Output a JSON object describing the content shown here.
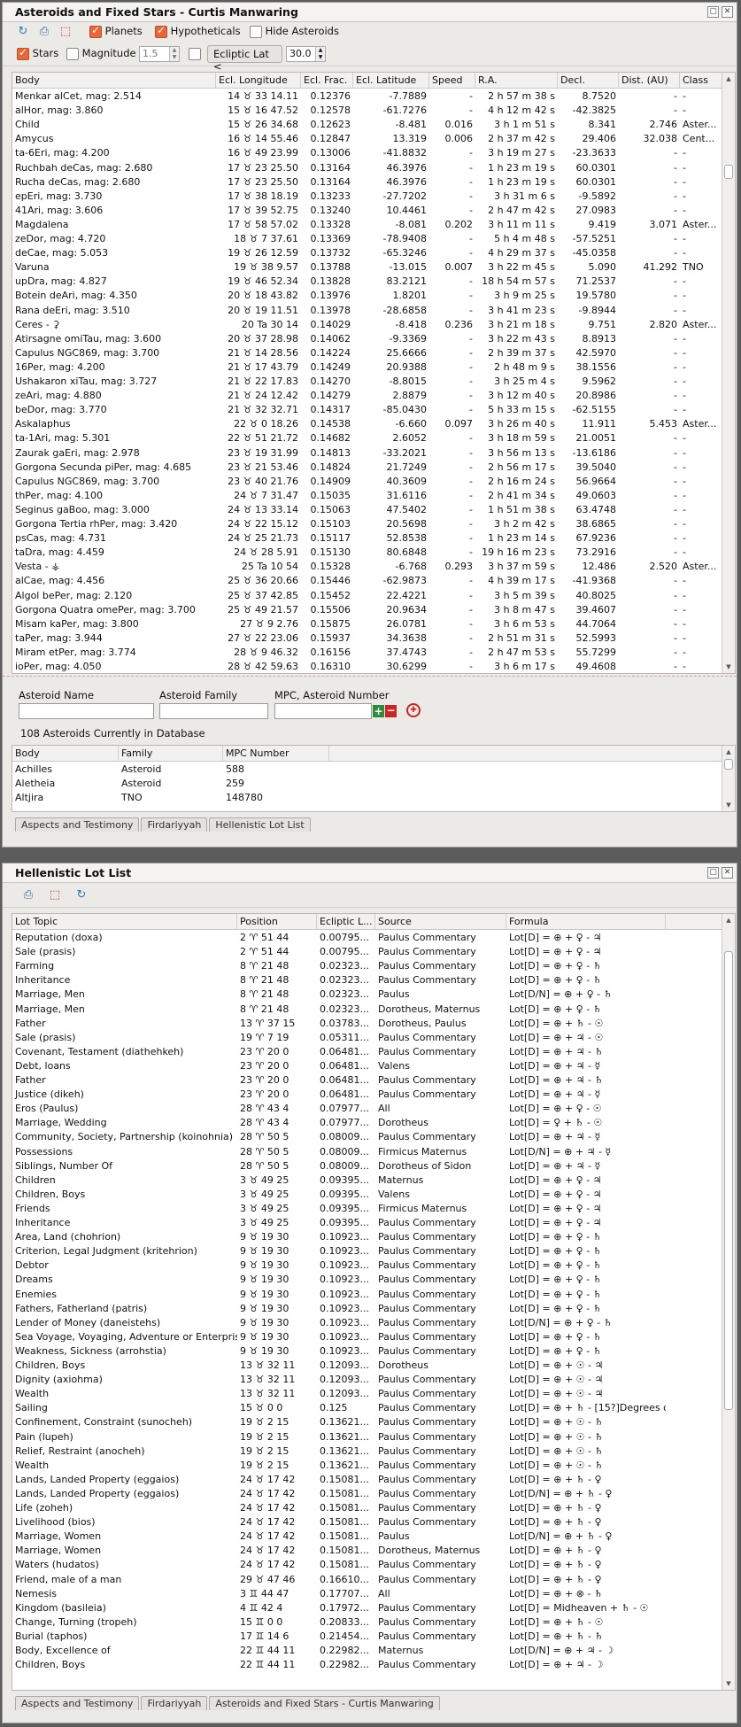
{
  "top": {
    "title": "Asteroids and Fixed Stars - Curtis Manwaring",
    "toolbar": {
      "planets": "Planets",
      "hypotheticals": "Hypotheticals",
      "hide": "Hide Asteroids",
      "stars": "Stars",
      "magnitude": "Magnitude <",
      "mag_value": "1.5",
      "ecliptic": "Ecliptic Lat <",
      "ecl_value": "30.0"
    },
    "columns": [
      "Body",
      "Ecl. Longitude",
      "Ecl. Frac.",
      "Ecl. Latitude",
      "Speed",
      "R.A.",
      "Decl.",
      "Dist. (AU)",
      "Class"
    ],
    "rows": [
      [
        "Menkar   alCet, mag: 2.514",
        "14 ♉ 33 14.11",
        "0.12376",
        "-7.7889",
        "-",
        "2 h 57 m 38 s",
        "8.7520",
        "-",
        "-"
      ],
      [
        "   alHor, mag: 3.860",
        "15 ♉ 16 47.52",
        "0.12578",
        "-61.7276",
        "-",
        "4 h 12 m 42 s",
        "-42.3825",
        "-",
        "-"
      ],
      [
        "Child",
        "15 ♉ 26 34.68",
        "0.12623",
        "-8.481",
        "0.016",
        "3 h 1 m 51 s",
        "8.341",
        "2.746",
        "Aster..."
      ],
      [
        "Amycus",
        "16 ♉ 14 55.46",
        "0.12847",
        "13.319",
        "0.006",
        "2 h 37 m 42 s",
        "29.406",
        "32.038",
        "Cent..."
      ],
      [
        "   ta-6Eri, mag: 4.200",
        "16 ♉ 49 23.99",
        "0.13006",
        "-41.8832",
        "-",
        "3 h 19 m 27 s",
        "-23.3633",
        "-",
        "-"
      ],
      [
        "Ruchbah   deCas, mag: 2.680",
        "17 ♉ 23 25.50",
        "0.13164",
        "46.3976",
        "-",
        "1 h 23 m 19 s",
        "60.0301",
        "-",
        "-"
      ],
      [
        "Rucha   deCas, mag: 2.680",
        "17 ♉ 23 25.50",
        "0.13164",
        "46.3976",
        "-",
        "1 h 23 m 19 s",
        "60.0301",
        "-",
        "-"
      ],
      [
        "   epEri, mag: 3.730",
        "17 ♉ 38 18.19",
        "0.13233",
        "-27.7202",
        "-",
        "3 h 31 m 6 s",
        "-9.5892",
        "-",
        "-"
      ],
      [
        "   41Ari, mag: 3.606",
        "17 ♉ 39 52.75",
        "0.13240",
        "10.4461",
        "-",
        "2 h 47 m 42 s",
        "27.0983",
        "-",
        "-"
      ],
      [
        "Magdalena",
        "17 ♉ 58 57.02",
        "0.13328",
        "-8.081",
        "0.202",
        "3 h 11 m 11 s",
        "9.419",
        "3.071",
        "Aster..."
      ],
      [
        "   zeDor, mag: 4.720",
        "18 ♉ 7 37.61",
        "0.13369",
        "-78.9408",
        "-",
        "5 h 4 m 48 s",
        "-57.5251",
        "-",
        "-"
      ],
      [
        "   deCae, mag: 5.053",
        "19 ♉ 26 12.59",
        "0.13732",
        "-65.3246",
        "-",
        "4 h 29 m 37 s",
        "-45.0358",
        "-",
        "-"
      ],
      [
        "Varuna",
        "19 ♉ 38 9.57",
        "0.13788",
        "-13.015",
        "0.007",
        "3 h 22 m 45 s",
        "5.090",
        "41.292",
        "TNO"
      ],
      [
        "   upDra, mag: 4.827",
        "19 ♉ 46 52.34",
        "0.13828",
        "83.2121",
        "-",
        "18 h 54 m 57 s",
        "71.2537",
        "-",
        "-"
      ],
      [
        "Botein   deAri, mag: 4.350",
        "20 ♉ 18 43.82",
        "0.13976",
        "1.8201",
        "-",
        "3 h 9 m 25 s",
        "19.5780",
        "-",
        "-"
      ],
      [
        "Rana   deEri, mag: 3.510",
        "20 ♉ 19 11.51",
        "0.13978",
        "-28.6858",
        "-",
        "3 h 41 m 23 s",
        "-9.8944",
        "-",
        "-"
      ],
      [
        "Ceres - ⚳",
        "20 Ta 30 14",
        "0.14029",
        "-8.418",
        "0.236",
        "3 h 21 m 18 s",
        "9.751",
        "2.820",
        "Aster..."
      ],
      [
        "Atirsagne   omiTau, mag: 3.600",
        "20 ♉ 37 28.98",
        "0.14062",
        "-9.3369",
        "-",
        "3 h 22 m 43 s",
        "8.8913",
        "-",
        "-"
      ],
      [
        "Capulus   NGC869, mag: 3.700",
        "21 ♉ 14 28.56",
        "0.14224",
        "25.6666",
        "-",
        "2 h 39 m 37 s",
        "42.5970",
        "-",
        "-"
      ],
      [
        "   16Per, mag: 4.200",
        "21 ♉ 17 43.79",
        "0.14249",
        "20.9388",
        "-",
        "2 h 48 m 9 s",
        "38.1556",
        "-",
        "-"
      ],
      [
        "Ushakaron   xiTau, mag: 3.727",
        "21 ♉ 22 17.83",
        "0.14270",
        "-8.8015",
        "-",
        "3 h 25 m 4 s",
        "9.5962",
        "-",
        "-"
      ],
      [
        "   zeAri, mag: 4.880",
        "21 ♉ 24 12.42",
        "0.14279",
        "2.8879",
        "-",
        "3 h 12 m 40 s",
        "20.8986",
        "-",
        "-"
      ],
      [
        "   beDor, mag: 3.770",
        "21 ♉ 32 32.71",
        "0.14317",
        "-85.0430",
        "-",
        "5 h 33 m 15 s",
        "-62.5155",
        "-",
        "-"
      ],
      [
        "Askalaphus",
        "22 ♉ 0 18.26",
        "0.14538",
        "-6.660",
        "0.097",
        "3 h 26 m 40 s",
        "11.911",
        "5.453",
        "Aster..."
      ],
      [
        "   ta-1Ari, mag: 5.301",
        "22 ♉ 51 21.72",
        "0.14682",
        "2.6052",
        "-",
        "3 h 18 m 59 s",
        "21.0051",
        "-",
        "-"
      ],
      [
        "Zaurak   gaEri, mag: 2.978",
        "23 ♉ 19 31.99",
        "0.14813",
        "-33.2021",
        "-",
        "3 h 56 m 13 s",
        "-13.6186",
        "-",
        "-"
      ],
      [
        "Gorgona Secunda   piPer, mag: 4.685",
        "23 ♉ 21 53.46",
        "0.14824",
        "21.7249",
        "-",
        "2 h 56 m 17 s",
        "39.5040",
        "-",
        "-"
      ],
      [
        "Capulus   NGC869, mag: 3.700",
        "23 ♉ 40 21.76",
        "0.14909",
        "40.3609",
        "-",
        "2 h 16 m 24 s",
        "56.9664",
        "-",
        "-"
      ],
      [
        "   thPer, mag: 4.100",
        "24 ♉ 7 31.47",
        "0.15035",
        "31.6116",
        "-",
        "2 h 41 m 34 s",
        "49.0603",
        "-",
        "-"
      ],
      [
        "Seginus   gaBoo, mag: 3.000",
        "24 ♉ 13 33.14",
        "0.15063",
        "47.5402",
        "-",
        "1 h 51 m 38 s",
        "63.4748",
        "-",
        "-"
      ],
      [
        "Gorgona Tertia   rhPer, mag: 3.420",
        "24 ♉ 22 15.12",
        "0.15103",
        "20.5698",
        "-",
        "3 h 2 m 42 s",
        "38.6865",
        "-",
        "-"
      ],
      [
        "   psCas, mag: 4.731",
        "24 ♉ 25 21.73",
        "0.15117",
        "52.8538",
        "-",
        "1 h 23 m 14 s",
        "67.9236",
        "-",
        "-"
      ],
      [
        "   taDra, mag: 4.459",
        "24 ♉ 28 5.91",
        "0.15130",
        "80.6848",
        "-",
        "19 h 16 m 23 s",
        "73.2916",
        "-",
        "-"
      ],
      [
        "Vesta - ⚶",
        "25 Ta 10 54",
        "0.15328",
        "-6.768",
        "0.293",
        "3 h 37 m 59 s",
        "12.486",
        "2.520",
        "Aster..."
      ],
      [
        "   alCae, mag: 4.456",
        "25 ♉ 36 20.66",
        "0.15446",
        "-62.9873",
        "-",
        "4 h 39 m 17 s",
        "-41.9368",
        "-",
        "-"
      ],
      [
        "Algol   bePer, mag: 2.120",
        "25 ♉ 37 42.85",
        "0.15452",
        "22.4221",
        "-",
        "3 h 5 m 39 s",
        "40.8025",
        "-",
        "-"
      ],
      [
        "Gorgona Quatra   omePer, mag: 3.700",
        "25 ♉ 49 21.57",
        "0.15506",
        "20.9634",
        "-",
        "3 h 8 m 47 s",
        "39.4607",
        "-",
        "-"
      ],
      [
        "Misam   kaPer, mag: 3.800",
        "27 ♉ 9 2.76",
        "0.15875",
        "26.0781",
        "-",
        "3 h 6 m 53 s",
        "44.7064",
        "-",
        "-"
      ],
      [
        "   taPer, mag: 3.944",
        "27 ♉ 22 23.06",
        "0.15937",
        "34.3638",
        "-",
        "2 h 51 m 31 s",
        "52.5993",
        "-",
        "-"
      ],
      [
        "Miram   etPer, mag: 3.774",
        "28 ♉ 9 46.32",
        "0.16156",
        "37.4743",
        "-",
        "2 h 47 m 53 s",
        "55.7299",
        "-",
        "-"
      ],
      [
        "   ioPer, mag: 4.050",
        "28 ♉ 42 59.63",
        "0.16310",
        "30.6299",
        "-",
        "3 h 6 m 17 s",
        "49.4608",
        "-",
        "-"
      ]
    ],
    "search": {
      "name_label": "Asteroid Name",
      "family_label": "Asteroid Family",
      "mpc_label": "MPC, Asteroid Number",
      "count": "108 Asteroids Currently in Database"
    },
    "db_columns": [
      "Body",
      "Family",
      "MPC Number"
    ],
    "db_rows": [
      [
        "Achilles",
        "Asteroid",
        "588"
      ],
      [
        "Aletheia",
        "Asteroid",
        "259"
      ],
      [
        "Altjira",
        "TNO",
        "148780"
      ]
    ],
    "tabs": [
      "Aspects and Testimony",
      "Firdariyyah",
      "Hellenistic Lot List"
    ]
  },
  "bottom": {
    "title": "Hellenistic Lot List",
    "columns": [
      "Lot Topic",
      "Position",
      "Ecliptic L...",
      "Source",
      "Formula"
    ],
    "rows": [
      [
        "Reputation (doxa)",
        "2 ♈ 51 44",
        "0.00795...",
        "Paulus Commentary",
        "Lot[D] = ⊕ + ♀ - ♃"
      ],
      [
        "Sale (prasis)",
        "2 ♈ 51 44",
        "0.00795...",
        "Paulus Commentary",
        "Lot[D] = ⊕ + ♀ - ♃"
      ],
      [
        "Farming",
        "8 ♈ 21 48",
        "0.02323...",
        "Paulus Commentary",
        "Lot[D] = ⊕ + ♀ - ♄"
      ],
      [
        "Inheritance",
        "8 ♈ 21 48",
        "0.02323...",
        "Paulus Commentary",
        "Lot[D] = ⊕ + ♀ - ♄"
      ],
      [
        "Marriage, Men",
        "8 ♈ 21 48",
        "0.02323...",
        "Paulus",
        "Lot[D/N] = ⊕ + ♀ - ♄"
      ],
      [
        "Marriage, Men",
        "8 ♈ 21 48",
        "0.02323...",
        "Dorotheus, Maternus",
        "Lot[D] = ⊕ + ♀ - ♄"
      ],
      [
        "Father",
        "13 ♈ 37 15",
        "0.03783...",
        "Dorotheus, Paulus",
        "Lot[D] = ⊕ + ♄ - ☉"
      ],
      [
        "Sale (prasis)",
        "19 ♈ 7 19",
        "0.05311...",
        "Paulus Commentary",
        "Lot[D] = ⊕ + ♃ - ☉"
      ],
      [
        "Covenant, Testament (diathehkeh)",
        "23 ♈ 20 0",
        "0.06481...",
        "Paulus Commentary",
        "Lot[D] = ⊕ + ♃ - ♄"
      ],
      [
        "Debt, loans",
        "23 ♈ 20 0",
        "0.06481...",
        "Valens",
        "Lot[D] = ⊕ + ♃ - ☿"
      ],
      [
        "Father",
        "23 ♈ 20 0",
        "0.06481...",
        "Paulus Commentary",
        "Lot[D] = ⊕ + ♃ - ♄"
      ],
      [
        "Justice (dikeh)",
        "23 ♈ 20 0",
        "0.06481...",
        "Paulus Commentary",
        "Lot[D] = ⊕ + ♃ - ☿"
      ],
      [
        "Eros (Paulus)",
        "28 ♈ 43 4",
        "0.07977...",
        "All",
        "Lot[D] = ⊕ + ♀ - ☉"
      ],
      [
        "Marriage, Wedding",
        "28 ♈ 43 4",
        "0.07977...",
        "Dorotheus",
        "Lot[D] = ♀ + ♄ - ☉"
      ],
      [
        "Community, Society, Partnership (koinohnia)",
        "28 ♈ 50 5",
        "0.08009...",
        "Paulus Commentary",
        "Lot[D] = ⊕ + ♃ - ☿"
      ],
      [
        "Possessions",
        "28 ♈ 50 5",
        "0.08009...",
        "Firmicus Maternus",
        "Lot[D/N] = ⊕ + ♃ - ☿"
      ],
      [
        "Siblings, Number Of",
        "28 ♈ 50 5",
        "0.08009...",
        "Dorotheus of Sidon",
        "Lot[D] = ⊕ + ♃ - ☿"
      ],
      [
        "Children",
        "3 ♉ 49 25",
        "0.09395...",
        "Maternus",
        "Lot[D] = ⊕ + ♀ - ♃"
      ],
      [
        "Children, Boys",
        "3 ♉ 49 25",
        "0.09395...",
        "Valens",
        "Lot[D] = ⊕ + ♀ - ♃"
      ],
      [
        "Friends",
        "3 ♉ 49 25",
        "0.09395...",
        "Firmicus Maternus",
        "Lot[D] = ⊕ + ♀ - ♃"
      ],
      [
        "Inheritance",
        "3 ♉ 49 25",
        "0.09395...",
        "Paulus Commentary",
        "Lot[D] = ⊕ + ♀ - ♃"
      ],
      [
        "Area, Land (chohrion)",
        "9 ♉ 19 30",
        "0.10923...",
        "Paulus Commentary",
        "Lot[D] = ⊕ + ♀ - ♄"
      ],
      [
        "Criterion, Legal Judgment (kritehrion)",
        "9 ♉ 19 30",
        "0.10923...",
        "Paulus Commentary",
        "Lot[D] = ⊕ + ♀ - ♄"
      ],
      [
        "Debtor",
        "9 ♉ 19 30",
        "0.10923...",
        "Paulus Commentary",
        "Lot[D] = ⊕ + ♀ - ♄"
      ],
      [
        "Dreams",
        "9 ♉ 19 30",
        "0.10923...",
        "Paulus Commentary",
        "Lot[D] = ⊕ + ♀ - ♄"
      ],
      [
        "Enemies",
        "9 ♉ 19 30",
        "0.10923...",
        "Paulus Commentary",
        "Lot[D] = ⊕ + ♀ - ♄"
      ],
      [
        "Fathers, Fatherland (patris)",
        "9 ♉ 19 30",
        "0.10923...",
        "Paulus Commentary",
        "Lot[D] = ⊕ + ♀ - ♄"
      ],
      [
        "Lender of Money (daneistehs)",
        "9 ♉ 19 30",
        "0.10923...",
        "Paulus Commentary",
        "Lot[D/N] = ⊕ + ♀ - ♄"
      ],
      [
        "Sea Voyage, Voyaging, Adventure or Enterprise",
        "9 ♉ 19 30",
        "0.10923...",
        "Paulus Commentary",
        "Lot[D] = ⊕ + ♀ - ♄"
      ],
      [
        "Weakness, Sickness (arrohstia)",
        "9 ♉ 19 30",
        "0.10923...",
        "Paulus Commentary",
        "Lot[D] = ⊕ + ♀ - ♄"
      ],
      [
        "Children, Boys",
        "13 ♉ 32 11",
        "0.12093...",
        "Dorotheus",
        "Lot[D] = ⊕ + ☉ - ♃"
      ],
      [
        "Dignity (axiohma)",
        "13 ♉ 32 11",
        "0.12093...",
        "Paulus Commentary",
        "Lot[D] = ⊕ + ☉ - ♃"
      ],
      [
        "Wealth",
        "13 ♉ 32 11",
        "0.12093...",
        "Paulus Commentary",
        "Lot[D] = ⊕ + ☉ - ♃"
      ],
      [
        "Sailing",
        "15 ♉ 0 0",
        "0.125",
        "Paulus Commentary",
        "Lot[D] = ⊕ + ♄ - [15?]Degrees o..."
      ],
      [
        "Confinement, Constraint (sunocheh)",
        "19 ♉ 2 15",
        "0.13621...",
        "Paulus Commentary",
        "Lot[D] = ⊕ + ☉ - ♄"
      ],
      [
        "Pain (lupeh)",
        "19 ♉ 2 15",
        "0.13621...",
        "Paulus Commentary",
        "Lot[D] = ⊕ + ☉ - ♄"
      ],
      [
        "Relief, Restraint (anocheh)",
        "19 ♉ 2 15",
        "0.13621...",
        "Paulus Commentary",
        "Lot[D] = ⊕ + ☉ - ♄"
      ],
      [
        "Wealth",
        "19 ♉ 2 15",
        "0.13621...",
        "Paulus Commentary",
        "Lot[D] = ⊕ + ☉ - ♄"
      ],
      [
        "Lands, Landed Property (eggaios)",
        "24 ♉ 17 42",
        "0.15081...",
        "Paulus Commentary",
        "Lot[D] = ⊕ + ♄ - ♀"
      ],
      [
        "Lands, Landed Property (eggaios)",
        "24 ♉ 17 42",
        "0.15081...",
        "Paulus Commentary",
        "Lot[D/N] = ⊕ + ♄ - ♀"
      ],
      [
        "Life (zoheh)",
        "24 ♉ 17 42",
        "0.15081...",
        "Paulus Commentary",
        "Lot[D] = ⊕ + ♄ - ♀"
      ],
      [
        "Livelihood (bios)",
        "24 ♉ 17 42",
        "0.15081...",
        "Paulus Commentary",
        "Lot[D] = ⊕ + ♄ - ♀"
      ],
      [
        "Marriage, Women",
        "24 ♉ 17 42",
        "0.15081...",
        "Paulus",
        "Lot[D/N] = ⊕ + ♄ - ♀"
      ],
      [
        "Marriage, Women",
        "24 ♉ 17 42",
        "0.15081...",
        "Dorotheus, Maternus",
        "Lot[D] = ⊕ + ♄ - ♀"
      ],
      [
        "Waters (hudatos)",
        "24 ♉ 17 42",
        "0.15081...",
        "Paulus Commentary",
        "Lot[D] = ⊕ + ♄ - ♀"
      ],
      [
        "Friend, male of a man",
        "29 ♉ 47 46",
        "0.16610...",
        "Paulus Commentary",
        "Lot[D] = ⊕ + ♄ - ♀"
      ],
      [
        "Nemesis",
        "3 ♊ 44 47",
        "0.17707...",
        "All",
        "Lot[D] = ⊕ + ⊗ - ♄"
      ],
      [
        "Kingdom (basileia)",
        "4 ♊ 42 4",
        "0.17972...",
        "Paulus Commentary",
        "Lot[D] = Midheaven + ♄ - ☉"
      ],
      [
        "Change, Turning (tropeh)",
        "15 ♊ 0 0",
        "0.20833...",
        "Paulus Commentary",
        "Lot[D] = ⊕ + ♄ - ☉"
      ],
      [
        "Burial (taphos)",
        "17 ♊ 14 6",
        "0.21454...",
        "Paulus Commentary",
        "Lot[D] = ⊕ + ♄ - ♄"
      ],
      [
        "Body, Excellence of",
        "22 ♊ 44 11",
        "0.22982...",
        "Maternus",
        "Lot[D/N] = ⊕ + ♃ - ☽"
      ],
      [
        "Children, Boys",
        "22 ♊ 44 11",
        "0.22982...",
        "Paulus Commentary",
        "Lot[D] = ⊕ + ♃ - ☽"
      ]
    ],
    "tabs": [
      "Aspects and Testimony",
      "Firdariyyah",
      "Asteroids and Fixed Stars - Curtis Manwaring"
    ]
  },
  "colors": {
    "check": "#e8673a",
    "panel": "#eceae6",
    "frame": "#5c5c5c"
  }
}
